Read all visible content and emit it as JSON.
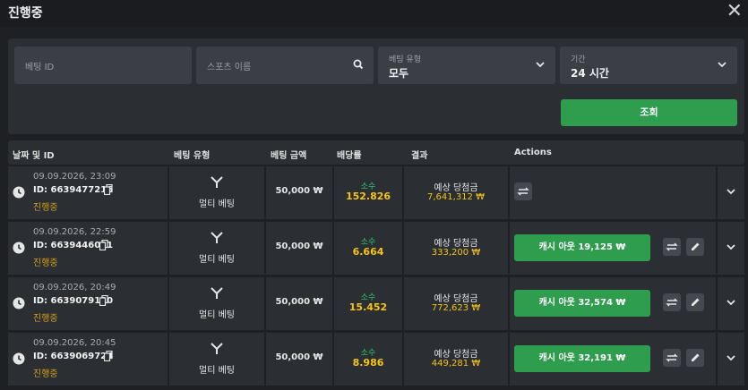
{
  "header": {
    "title": "진행중",
    "close_label": "✕"
  },
  "filters": {
    "bet_id_placeholder": "베팅 ID",
    "sport_name_placeholder": "스포츠 이름",
    "bet_type_label": "베팅 유형",
    "bet_type_value": "모두",
    "period_label": "기간",
    "period_value": "24 시간",
    "query_button": "조회"
  },
  "table": {
    "columns": [
      "날짜 및 ID",
      "베팅 유형",
      "베팅 금액",
      "배당률",
      "결과",
      "Actions"
    ],
    "rows": [
      {
        "date": "09.09.2026, 23:09",
        "id": "ID: 6639477216",
        "status": "진행중",
        "bet_type": "멀티 베팅",
        "amount": "50,000 ₩",
        "odds_label": "소수",
        "odds": "152.826",
        "payout_label": "예상 당첨금",
        "payout": "7,641,312 ₩",
        "cashout": ""
      },
      {
        "date": "09.09.2026, 22:59",
        "id": "ID: 6639446011",
        "status": "진행중",
        "bet_type": "멀티 베팅",
        "amount": "50,000 ₩",
        "odds_label": "소수",
        "odds": "6.664",
        "payout_label": "예상 당첨금",
        "payout": "333,200 ₩",
        "cashout": "캐시 아웃 19,125 ₩"
      },
      {
        "date": "09.09.2026, 20:49",
        "id": "ID: 6639079110",
        "status": "진행중",
        "bet_type": "멀티 베팅",
        "amount": "50,000 ₩",
        "odds_label": "소수",
        "odds": "15.452",
        "payout_label": "예상 당첨금",
        "payout": "772,623 ₩",
        "cashout": "캐시 아웃 32,574 ₩"
      },
      {
        "date": "09.09.2026, 20:45",
        "id": "ID: 6639069724",
        "status": "진행중",
        "bet_type": "멀티 베팅",
        "amount": "50,000 ₩",
        "odds_label": "소수",
        "odds": "8.986",
        "payout_label": "예상 당첨금",
        "payout": "449,281 ₩",
        "cashout": "캐시 아웃 32,191 ₩"
      }
    ]
  },
  "colors": {
    "accent_green": "#2e9e4e",
    "odds_yellow": "#f5c518",
    "status_gold": "#d4a017",
    "odds_label_green": "#2ecc71"
  },
  "icons": {
    "clock": "clock-icon",
    "copy": "copy-icon",
    "multi": "multi-bet-icon",
    "swap": "swap-icon",
    "edit": "pencil-icon",
    "chevron": "chevron-down-icon",
    "search": "search-icon"
  }
}
